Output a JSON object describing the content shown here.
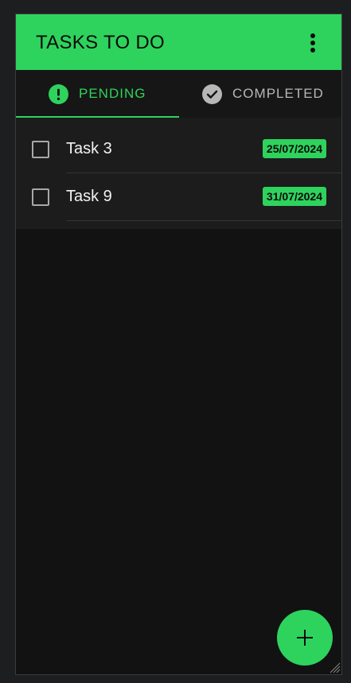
{
  "appbar": {
    "title": "TASKS TO DO",
    "menu_icon": "more-vertical-icon"
  },
  "tabs": [
    {
      "label": "PENDING",
      "icon": "alert-circle-icon",
      "active": true
    },
    {
      "label": "COMPLETED",
      "icon": "check-circle-icon",
      "active": false
    }
  ],
  "tasks": [
    {
      "name": "Task 3",
      "date": "25/07/2024",
      "checked": false
    },
    {
      "name": "Task 9",
      "date": "31/07/2024",
      "checked": false
    }
  ],
  "fab": {
    "icon": "plus-icon"
  },
  "colors": {
    "accent": "#2ed35d",
    "background": "#121212",
    "list_background": "#1c1c1c",
    "inactive_tab_text": "#b7b7b7"
  }
}
